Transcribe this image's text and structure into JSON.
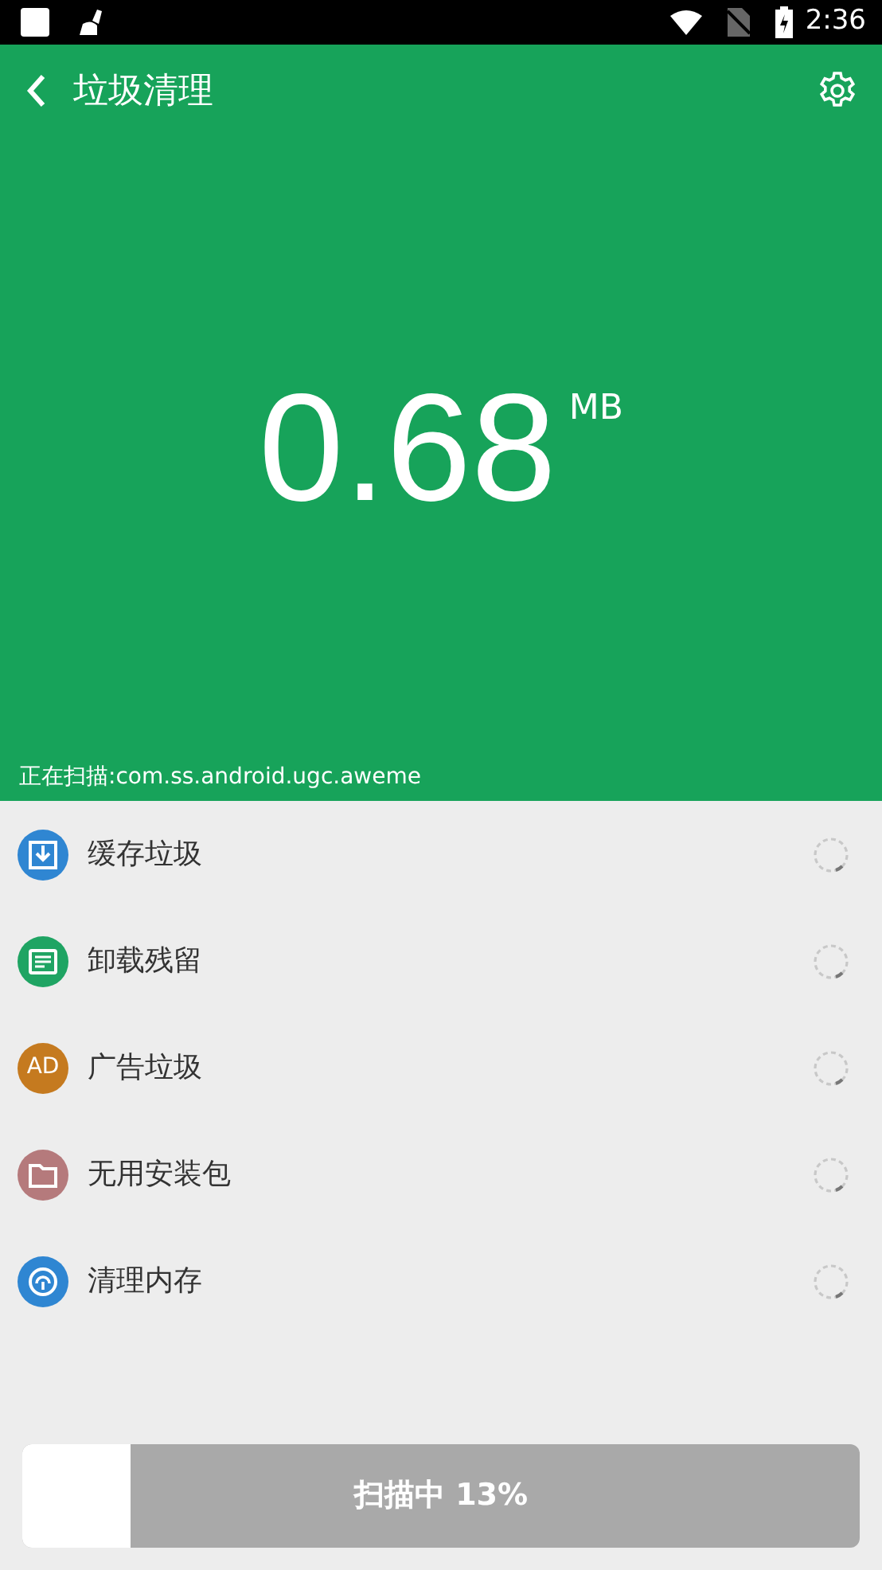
{
  "status_bar": {
    "time": "2:36"
  },
  "header": {
    "title": "垃圾清理",
    "size": "0.68",
    "unit": "MB",
    "scanning": "正在扫描:com.ss.android.ugc.aweme"
  },
  "items": [
    {
      "label": "缓存垃圾",
      "kind": "download",
      "color": "#2f86d2"
    },
    {
      "label": "卸载残留",
      "kind": "document",
      "color": "#1fa463"
    },
    {
      "label": "广告垃圾",
      "kind": "ad",
      "color": "#c57a1f",
      "icon_text": "AD"
    },
    {
      "label": "无用安装包",
      "kind": "folder",
      "color": "#b57a7c"
    },
    {
      "label": "清理内存",
      "kind": "memory",
      "color": "#2f86d2"
    }
  ],
  "progress": {
    "label": "扫描中 13%",
    "level": 0.13
  }
}
